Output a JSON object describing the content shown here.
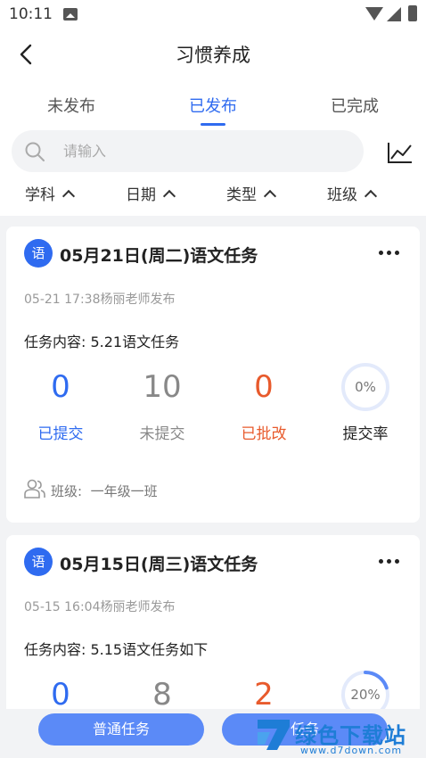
{
  "status_bar": {
    "time": "10:11"
  },
  "header": {
    "title": "习惯养成"
  },
  "tabs": [
    {
      "label": "未发布"
    },
    {
      "label": "已发布"
    },
    {
      "label": "已完成"
    }
  ],
  "search": {
    "placeholder": "请输入",
    "value": ""
  },
  "filters": [
    {
      "label": "学科"
    },
    {
      "label": "日期"
    },
    {
      "label": "类型"
    },
    {
      "label": "班级"
    }
  ],
  "tasks": [
    {
      "badge": "语",
      "title": "05月21日(周二)语文任务",
      "meta": "05-21 17:38杨丽老师发布",
      "content": "任务内容: 5.21语文任务",
      "submitted": "0",
      "submitted_label": "已提交",
      "unsubmitted": "10",
      "unsubmitted_label": "未提交",
      "reviewed": "0",
      "reviewed_label": "已批改",
      "rate": "0%",
      "rate_value": 0,
      "rate_label": "提交率",
      "class_label": "班级:",
      "class_name": "一年级一班"
    },
    {
      "badge": "语",
      "title": "05月15日(周三)语文任务",
      "meta": "05-15 16:04杨丽老师发布",
      "content": "任务内容: 5.15语文任务如下",
      "submitted": "0",
      "unsubmitted": "8",
      "reviewed": "2",
      "rate": "20%",
      "rate_value": 0.2
    }
  ],
  "bottom": {
    "normal_task": "普通任务",
    "other_task": "任务"
  },
  "watermark": {
    "text": "绿色下载站",
    "url": "www.d7down.com"
  },
  "colors": {
    "accent": "#2f6bf0",
    "alert": "#e85a2c",
    "button": "#5b8af7",
    "watermark": "#1e7dd6"
  }
}
